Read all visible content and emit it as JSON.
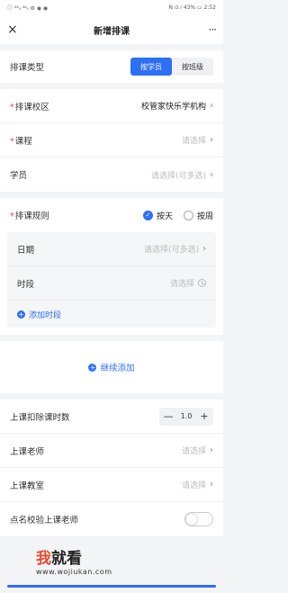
{
  "status": {
    "left": "ⓘ ⁴⁶ᵢₗ ⁴⁶ᵢₗ ⚙ ◉ ◉",
    "right": "N ⊙ ⁄ 43% ▭ 2:52"
  },
  "header": {
    "close": "×",
    "title": "新增排课",
    "more": "···"
  },
  "type": {
    "label": "排课类型",
    "options": [
      "按学员",
      "按班级"
    ],
    "selected": 0
  },
  "campus": {
    "label": "排课校区",
    "value": "校管家快乐学机构"
  },
  "course": {
    "label": "课程",
    "placeholder": "请选择"
  },
  "student": {
    "label": "学员",
    "placeholder": "请选择(可多选)"
  },
  "rule": {
    "label": "排课规则",
    "options": [
      "按天",
      "按周"
    ],
    "selected": 0
  },
  "date": {
    "label": "日期",
    "placeholder": "请选择(可多选)"
  },
  "slot": {
    "label": "时段",
    "placeholder": "请选择",
    "add": "添加时段"
  },
  "continue_label": "继续添加",
  "deduct": {
    "label": "上课扣除课时数",
    "value": "1.0",
    "minus": "—",
    "plus": "+"
  },
  "teacher": {
    "label": "上课老师",
    "placeholder": "请选择"
  },
  "room": {
    "label": "上课教室",
    "placeholder": "请选择"
  },
  "verify": {
    "label": "点名校验上课老师"
  },
  "watermark": {
    "brand_red": "我",
    "brand": "就看",
    "url": "www.wojiukan.com"
  },
  "colors": {
    "accent": "#2d6ff5",
    "required": "#e64848"
  }
}
